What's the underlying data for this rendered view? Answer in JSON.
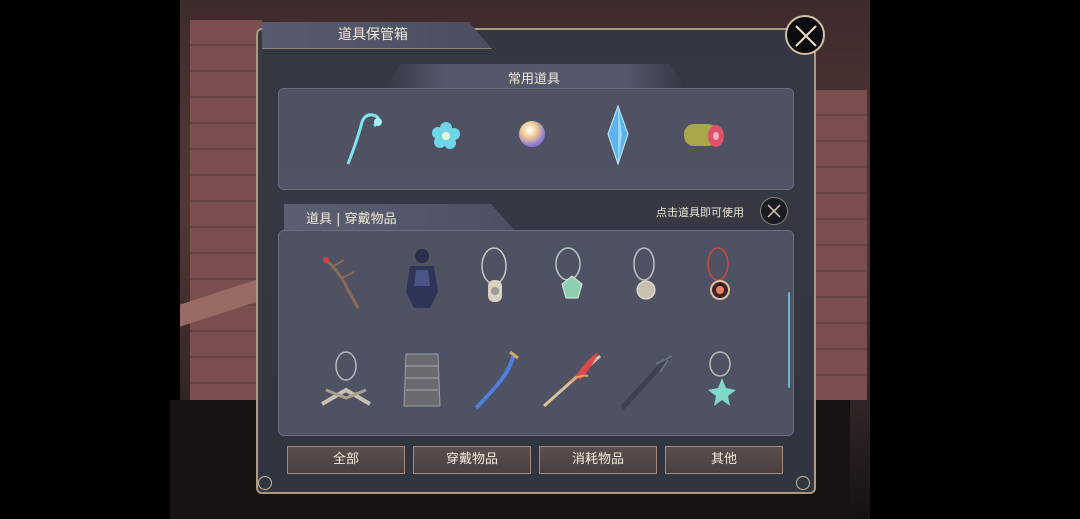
{
  "window": {
    "title": "道具保管箱"
  },
  "common_section": {
    "title": "常用道具",
    "items": [
      "staff-icon",
      "flower-icon",
      "orb-icon",
      "crystal-icon",
      "meat-icon"
    ]
  },
  "items_section": {
    "title": "道具 | 穿戴物品",
    "hint": "点击道具即可使用",
    "items": [
      "branch-staff-icon",
      "dark-armor-set-icon",
      "silver-pendant-icon",
      "green-gem-pendant-icon",
      "round-pendant-icon",
      "red-pendant-icon",
      "crossed-blades-pendant-icon",
      "breastplate-icon",
      "curved-sword-icon",
      "flame-spear-icon",
      "dark-sword-icon",
      "spiked-pendant-icon"
    ]
  },
  "filters": {
    "all": "全部",
    "wearables": "穿戴物品",
    "consumables": "消耗物品",
    "other": "其他"
  },
  "colors": {
    "accent": "#cfc2a6",
    "panel": "#343844",
    "cyan": "#6fd6e8"
  }
}
